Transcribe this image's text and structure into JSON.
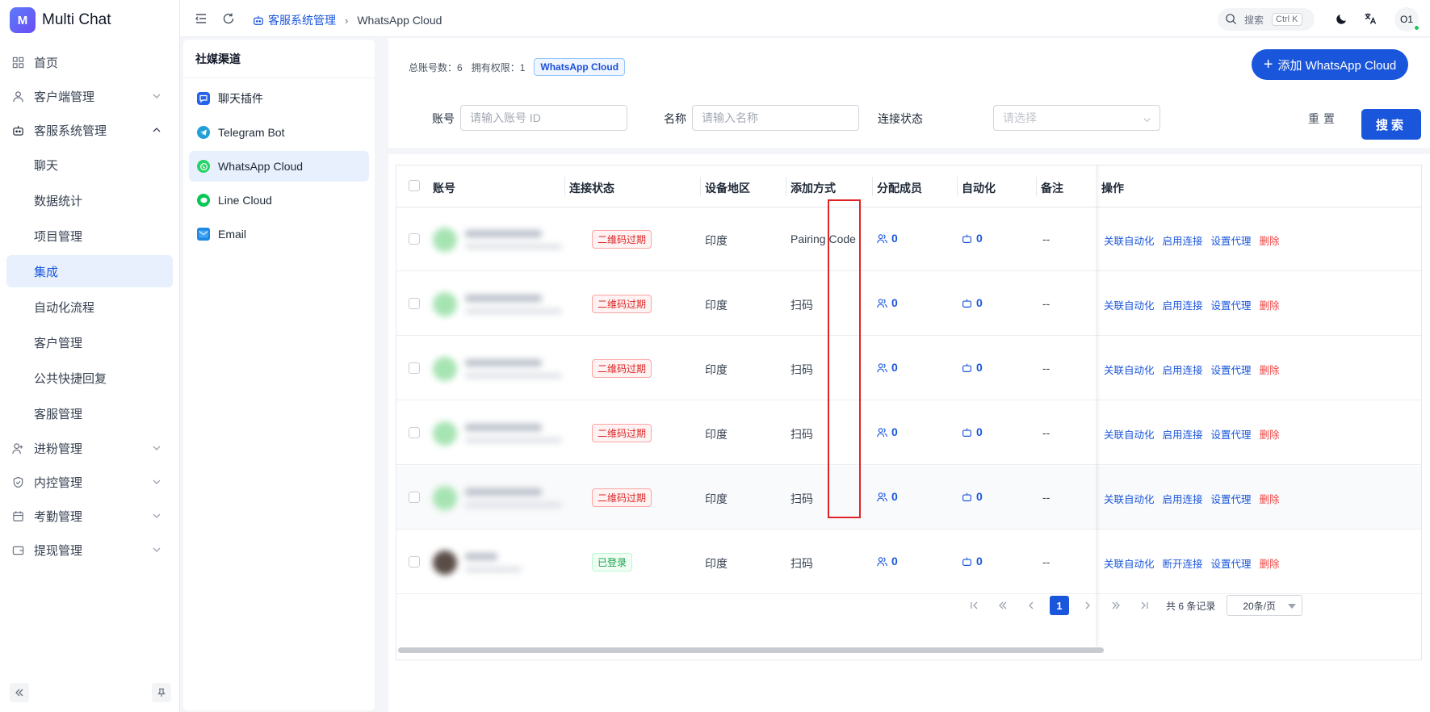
{
  "app": {
    "name": "Multi Chat",
    "logo_letter": "M"
  },
  "sidebar": {
    "items": [
      {
        "label": "首页",
        "icon": "grid-icon"
      },
      {
        "label": "客户端管理",
        "icon": "user-icon",
        "expandable": true
      },
      {
        "label": "客服系统管理",
        "icon": "robot-icon",
        "expanded": true
      }
    ],
    "sub_items": [
      "聊天",
      "数据统计",
      "项目管理",
      "集成",
      "自动化流程",
      "客户管理",
      "公共快捷回复",
      "客服管理"
    ],
    "active_sub": "集成",
    "bottom_items": [
      {
        "label": "进粉管理",
        "icon": "user-plus-icon"
      },
      {
        "label": "内控管理",
        "icon": "shield-icon"
      },
      {
        "label": "考勤管理",
        "icon": "calendar-icon"
      },
      {
        "label": "提现管理",
        "icon": "wallet-icon"
      }
    ]
  },
  "topbar": {
    "breadcrumb_parent": "客服系统管理",
    "breadcrumb_current": "WhatsApp Cloud",
    "search_placeholder": "搜索",
    "search_shortcut": "Ctrl K",
    "avatar_text": "O1"
  },
  "channels": {
    "title": "社媒渠道",
    "items": [
      {
        "label": "聊天插件",
        "icon": "chat-plugin-icon",
        "color": "#2563eb"
      },
      {
        "label": "Telegram Bot",
        "icon": "telegram-icon",
        "color": "#229ed9"
      },
      {
        "label": "WhatsApp Cloud",
        "icon": "whatsapp-icon",
        "color": "#25d366"
      },
      {
        "label": "Line Cloud",
        "icon": "line-icon",
        "color": "#06c755"
      },
      {
        "label": "Email",
        "icon": "email-icon",
        "color": "#1e88e5"
      }
    ],
    "active": "WhatsApp Cloud"
  },
  "main": {
    "stats": {
      "total_label": "总账号数：6",
      "perm_label": "拥有权限：1",
      "tag": "WhatsApp Cloud"
    },
    "add_button": "添加 WhatsApp Cloud",
    "filters": {
      "account_label": "账号",
      "account_placeholder": "请输入账号 ID",
      "name_label": "名称",
      "name_placeholder": "请输入名称",
      "status_label": "连接状态",
      "status_placeholder": "请选择"
    },
    "reset_button": "重置",
    "search_button": "搜索"
  },
  "table": {
    "columns": [
      "账号",
      "连接状态",
      "设备地区",
      "添加方式",
      "分配成员",
      "自动化",
      "备注",
      "操作"
    ],
    "rows": [
      {
        "status": "二维码过期",
        "status_type": "expired",
        "region": "印度",
        "method": "Pairing Code",
        "members": "0",
        "automation": "0",
        "remark": "--",
        "connect_op": "启用连接"
      },
      {
        "status": "二维码过期",
        "status_type": "expired",
        "region": "印度",
        "method": "扫码",
        "members": "0",
        "automation": "0",
        "remark": "--",
        "connect_op": "启用连接"
      },
      {
        "status": "二维码过期",
        "status_type": "expired",
        "region": "印度",
        "method": "扫码",
        "members": "0",
        "automation": "0",
        "remark": "--",
        "connect_op": "启用连接"
      },
      {
        "status": "二维码过期",
        "status_type": "expired",
        "region": "印度",
        "method": "扫码",
        "members": "0",
        "automation": "0",
        "remark": "--",
        "connect_op": "启用连接"
      },
      {
        "status": "二维码过期",
        "status_type": "expired",
        "region": "印度",
        "method": "扫码",
        "members": "0",
        "automation": "0",
        "remark": "--",
        "connect_op": "启用连接"
      },
      {
        "status": "已登录",
        "status_type": "online",
        "region": "印度",
        "method": "扫码",
        "members": "0",
        "automation": "0",
        "remark": "--",
        "connect_op": "断开连接"
      }
    ],
    "ops": {
      "link_automation": "关联自动化",
      "set_proxy": "设置代理",
      "delete": "删除"
    }
  },
  "pagination": {
    "current": "1",
    "total_text": "共 6 条记录",
    "page_size": "20条/页"
  },
  "colors": {
    "primary": "#1a56db",
    "danger": "#dc2626",
    "success": "#16a34a",
    "highlight": "#e02424"
  }
}
